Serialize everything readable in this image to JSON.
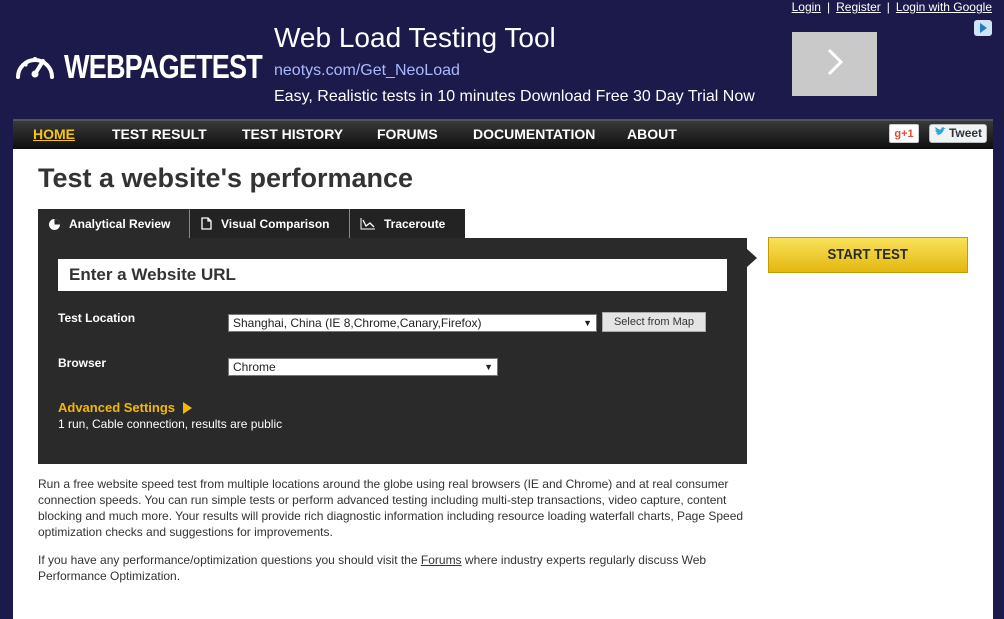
{
  "auth": {
    "login": "Login",
    "register": "Register",
    "google": "Login with Google",
    "sep": "|"
  },
  "logo": {
    "text": "WEBPAGETEST",
    "icon": "speedometer-icon"
  },
  "ad": {
    "title": "Web Load Testing Tool",
    "url": "neotys.com/Get_NeoLoad",
    "description": "Easy, Realistic tests in 10 minutes Download Free 30 Day Trial Now",
    "arrow_icon": "chevron-right-icon"
  },
  "nav": {
    "items": [
      "HOME",
      "TEST RESULT",
      "TEST HISTORY",
      "FORUMS",
      "DOCUMENTATION",
      "ABOUT"
    ],
    "active": "HOME",
    "gplus": "g+1",
    "tweet": "Tweet"
  },
  "main": {
    "title": "Test a website's performance",
    "tabs": [
      {
        "label": "Analytical Review",
        "icon": "pie-chart-icon"
      },
      {
        "label": "Visual Comparison",
        "icon": "document-icon"
      },
      {
        "label": "Traceroute",
        "icon": "route-icon"
      }
    ],
    "url_placeholder": "Enter a Website URL",
    "test_location_label": "Test Location",
    "test_location_value": "Shanghai, China (IE 8,Chrome,Canary,Firefox)",
    "select_from_map": "Select from Map",
    "browser_label": "Browser",
    "browser_value": "Chrome",
    "advanced_settings": "Advanced Settings",
    "advanced_summary": "1 run, Cable connection, results are public",
    "start_test": "START TEST",
    "paragraph1": "Run a free website speed test from multiple locations around the globe using real browsers (IE and Chrome) and at real consumer connection speeds. You can run simple tests or perform advanced testing including multi-step transactions, video capture, content blocking and much more. Your results will provide rich diagnostic information including resource loading waterfall charts, Page Speed optimization checks and suggestions for improvements.",
    "paragraph2_pre": "If you have any performance/optimization questions you should visit the ",
    "paragraph2_link": "Forums",
    "paragraph2_post": " where industry experts regularly discuss Web Performance Optimization."
  },
  "colors": {
    "header_bg": "#1c1a4a",
    "accent": "#f5c518",
    "panel_bg": "#2a2a2a"
  }
}
